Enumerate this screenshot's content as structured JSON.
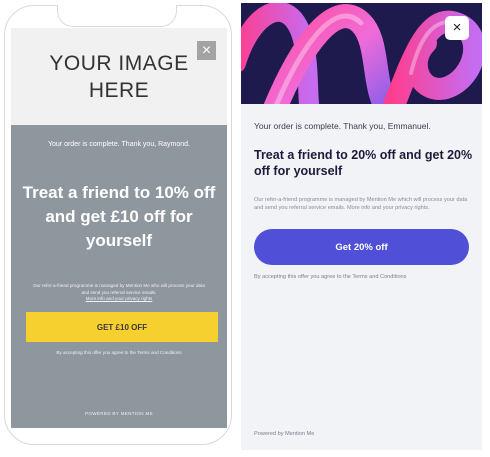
{
  "left_mockup": {
    "image_placeholder": "YOUR IMAGE\nHERE",
    "close_symbol": "×",
    "thanks": "Your order is complete. Thank you, Raymond.",
    "headline": "Treat a friend to 10% off and get £10 off for yourself",
    "privacy_text": "Our refer-a-friend programme is managed by Mention Me who will process your data and send you referral service emails.",
    "privacy_link": "More info and your privacy rights",
    "cta": "GET £10 OFF",
    "terms": "By accepting this offer you agree to the Terms and Conditions",
    "powered_by": "POWERED BY MENTION ME",
    "colors": {
      "panel": "#8e979e",
      "button": "#f6d02f"
    }
  },
  "right_popup": {
    "close_symbol": "×",
    "thanks": "Your order is complete. Thank you, Emmanuel.",
    "headline": "Treat a friend to 20% off and get 20% off for yourself",
    "privacy_text": "Our refer-a-friend programme is managed by Mention Me which will process your data and send you referral service emails. More info and your privacy rights.",
    "cta": "Get 20% off",
    "terms": "By accepting this offer you agree to the Terms and Conditions",
    "powered_by": "Powered by Mention Me",
    "colors": {
      "hero_bg": "#1e1a4d",
      "button": "#4f4fd8",
      "panel": "#f2f3f7"
    }
  }
}
